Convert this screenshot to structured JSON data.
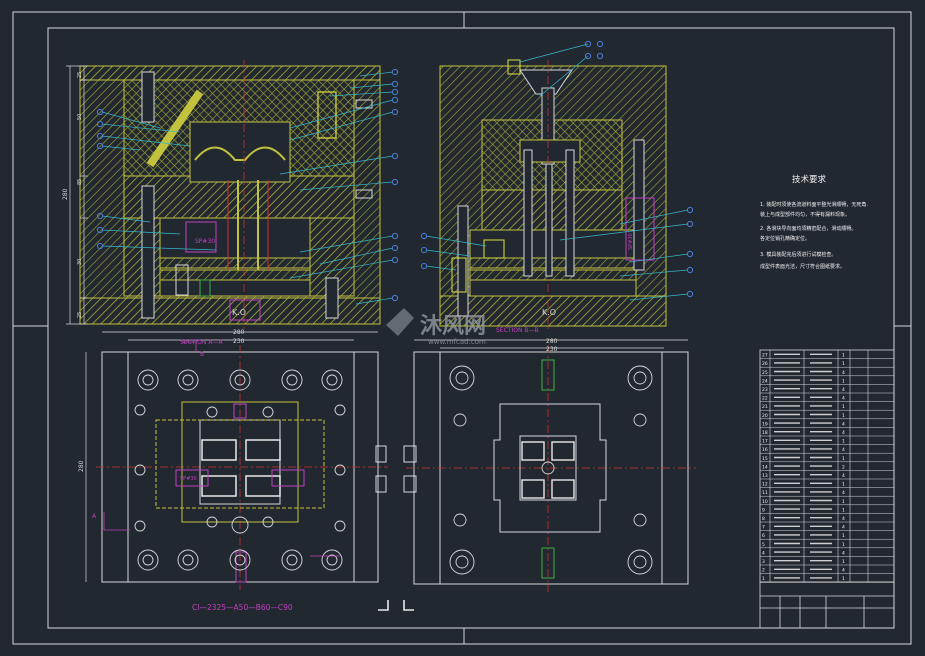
{
  "dims": {
    "top_a_w": "280",
    "top_b_w": "250",
    "left_h": "280",
    "left_seg": [
      "25",
      "50",
      "85",
      "30",
      "25"
    ],
    "bot_a_w": "280",
    "bot_a_w2": "230",
    "bot_b_w": "280",
    "bot_b_w2": "230",
    "bot_a_h": "280"
  },
  "labels": {
    "ko_a": "K.O",
    "ko_b": "K.O",
    "section_a": "SECTION A—A",
    "section_b": "SECTION B—B",
    "sp_a": "SP#30",
    "sp_b": "SP#30",
    "sp_c": "SP#30",
    "mold_code": "CI—2325—A50—B60—C90",
    "arrow_a": "A",
    "arrow_b": "B"
  },
  "tech": {
    "title": "技术要求",
    "lines": [
      "1. 装配时须使各流道料面平整光滑顺畅，无死角.",
      "装上与成型部件均匀，不得有漏料现象。",
      "2. 各滑块导向面均须精密配合，滑动顺畅。",
      "各定位销孔精确定位。",
      "3. 模具装配完后须进行试模检查。",
      "成型件表面光洁，尺寸符合图纸要求。"
    ]
  },
  "bom": {
    "rows": [
      [
        "27",
        "",
        "1",
        "",
        ""
      ],
      [
        "26",
        "",
        "1",
        "",
        ""
      ],
      [
        "25",
        "",
        "4",
        "",
        ""
      ],
      [
        "24",
        "",
        "1",
        "",
        ""
      ],
      [
        "23",
        "",
        "4",
        "",
        ""
      ],
      [
        "22",
        "",
        "4",
        "",
        ""
      ],
      [
        "21",
        "",
        "1",
        "",
        ""
      ],
      [
        "20",
        "",
        "1",
        "",
        ""
      ],
      [
        "19",
        "",
        "4",
        "",
        ""
      ],
      [
        "18",
        "",
        "4",
        "",
        ""
      ],
      [
        "17",
        "",
        "1",
        "",
        ""
      ],
      [
        "16",
        "",
        "4",
        "",
        ""
      ],
      [
        "15",
        "",
        "1",
        "",
        ""
      ],
      [
        "14",
        "",
        "2",
        "",
        ""
      ],
      [
        "13",
        "",
        "4",
        "",
        ""
      ],
      [
        "12",
        "",
        "1",
        "",
        ""
      ],
      [
        "11",
        "",
        "4",
        "",
        ""
      ],
      [
        "10",
        "",
        "1",
        "",
        ""
      ],
      [
        "9",
        "",
        "1",
        "",
        ""
      ],
      [
        "8",
        "",
        "4",
        "",
        ""
      ],
      [
        "7",
        "",
        "4",
        "",
        ""
      ],
      [
        "6",
        "",
        "1",
        "",
        ""
      ],
      [
        "5",
        "",
        "1",
        "",
        ""
      ],
      [
        "4",
        "",
        "4",
        "",
        ""
      ],
      [
        "3",
        "",
        "1",
        "",
        ""
      ],
      [
        "2",
        "",
        "4",
        "",
        ""
      ],
      [
        "1",
        "",
        "1",
        "",
        ""
      ]
    ],
    "footer_left": "",
    "footer_right": ""
  },
  "watermark": {
    "brand": "沐风网",
    "url": "www.mfcad.com"
  },
  "colors": {
    "bg": "#212830",
    "frame": "#d8d8d8",
    "hatch": "#b8b83a",
    "plate": "#c2c23e",
    "leader": "#34b8cc",
    "bubble": "#4a7ed8",
    "magenta": "#c040c0",
    "red": "#d03030",
    "white": "#e8e8e8",
    "green": "#40b040",
    "text_white": "#f0f0f0"
  }
}
